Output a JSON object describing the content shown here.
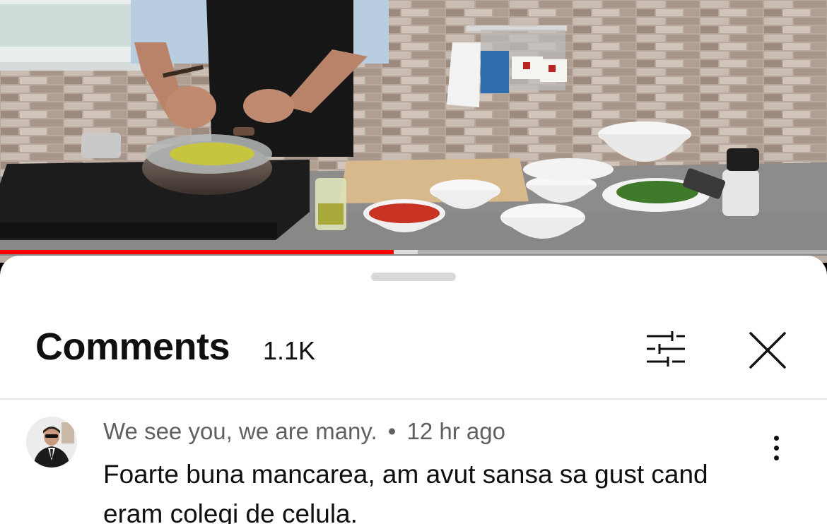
{
  "video": {
    "progress_fraction": 0.476,
    "progress_color": "#ff0000"
  },
  "comments": {
    "title": "Comments",
    "count": "1.1K",
    "filter_icon": "sliders-icon",
    "close_icon": "close-icon",
    "items": [
      {
        "author": "We see you, we are many.",
        "separator": "•",
        "time": "12 hr ago",
        "text": "Foarte buna mancarea, am avut sansa sa gust cand eram colegi de celula.",
        "menu_icon": "more-vertical-icon"
      }
    ]
  }
}
